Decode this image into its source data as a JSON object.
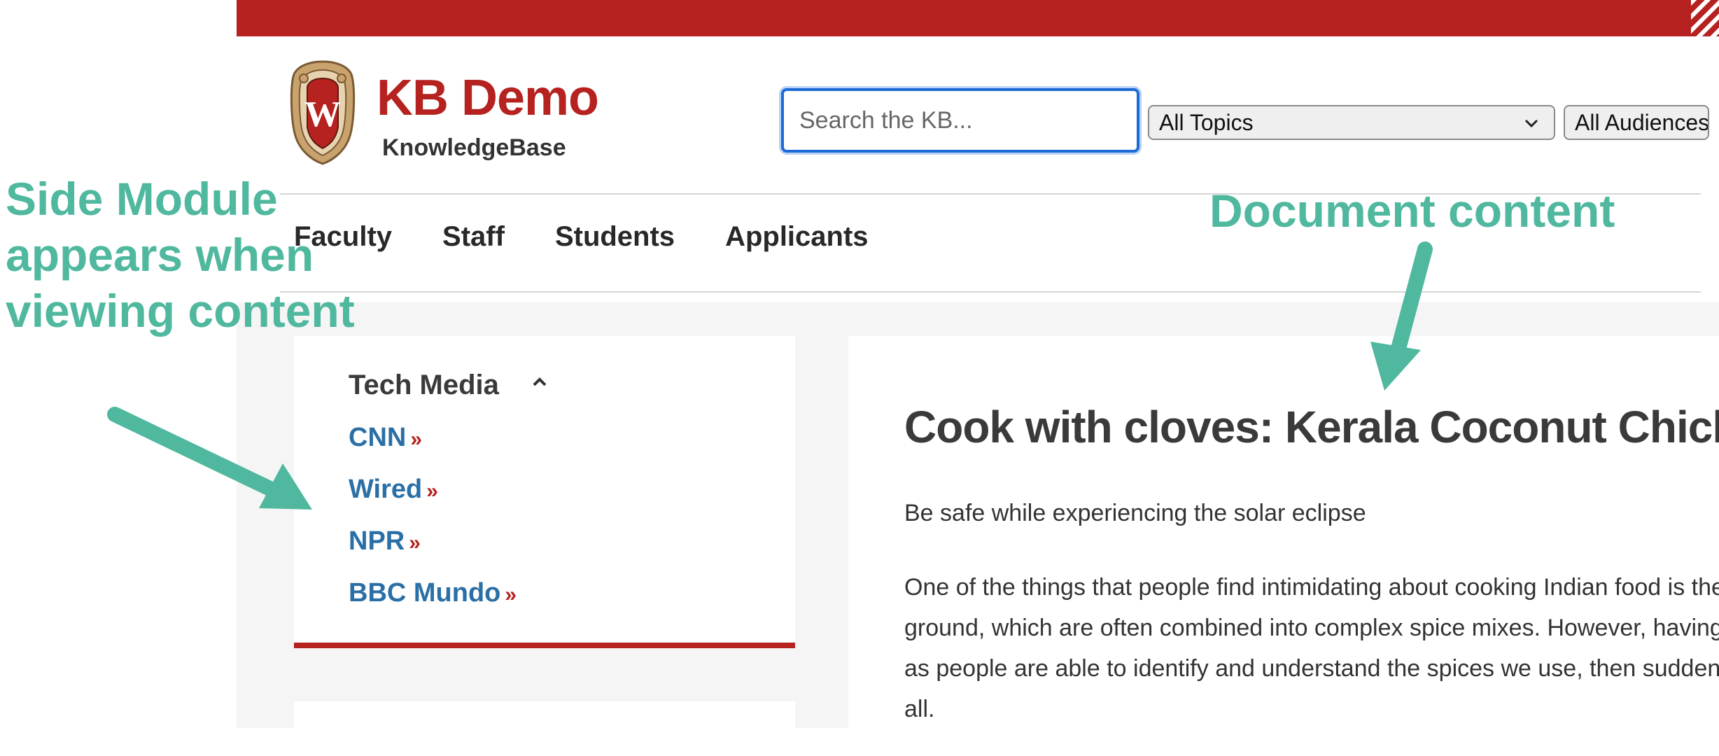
{
  "brand": {
    "title": "KB Demo",
    "subtitle": "KnowledgeBase",
    "crest_letter": "W",
    "accent_color": "#b5221f"
  },
  "search": {
    "placeholder": "Search the KB..."
  },
  "filters": {
    "topics_selected": "All Topics",
    "audiences_selected": "All Audiences"
  },
  "nav": {
    "items": [
      "Faculty",
      "Staff",
      "Students",
      "Applicants"
    ]
  },
  "side_module": {
    "title": "Tech Media",
    "links": [
      {
        "label": "CNN",
        "arrow": "»"
      },
      {
        "label": "Wired",
        "arrow": "»"
      },
      {
        "label": "NPR",
        "arrow": "»"
      },
      {
        "label": "BBC Mundo",
        "arrow": "»"
      }
    ],
    "link_color": "#2a6fa6"
  },
  "document": {
    "title": "Cook with cloves: Kerala Coconut Chicken",
    "subtitle": "Be safe while experiencing the solar eclipse",
    "paragraph_lines": [
      "One of the things that people find intimidating about cooking Indian food is the",
      "ground, which are often combined into complex spice mixes. However, having t",
      "as people are able to identify and understand the spices we use, then suddenly t",
      "all."
    ]
  },
  "annotations": {
    "left": "Side Module appears when viewing content",
    "right": "Document content",
    "color": "#4fb89e"
  }
}
